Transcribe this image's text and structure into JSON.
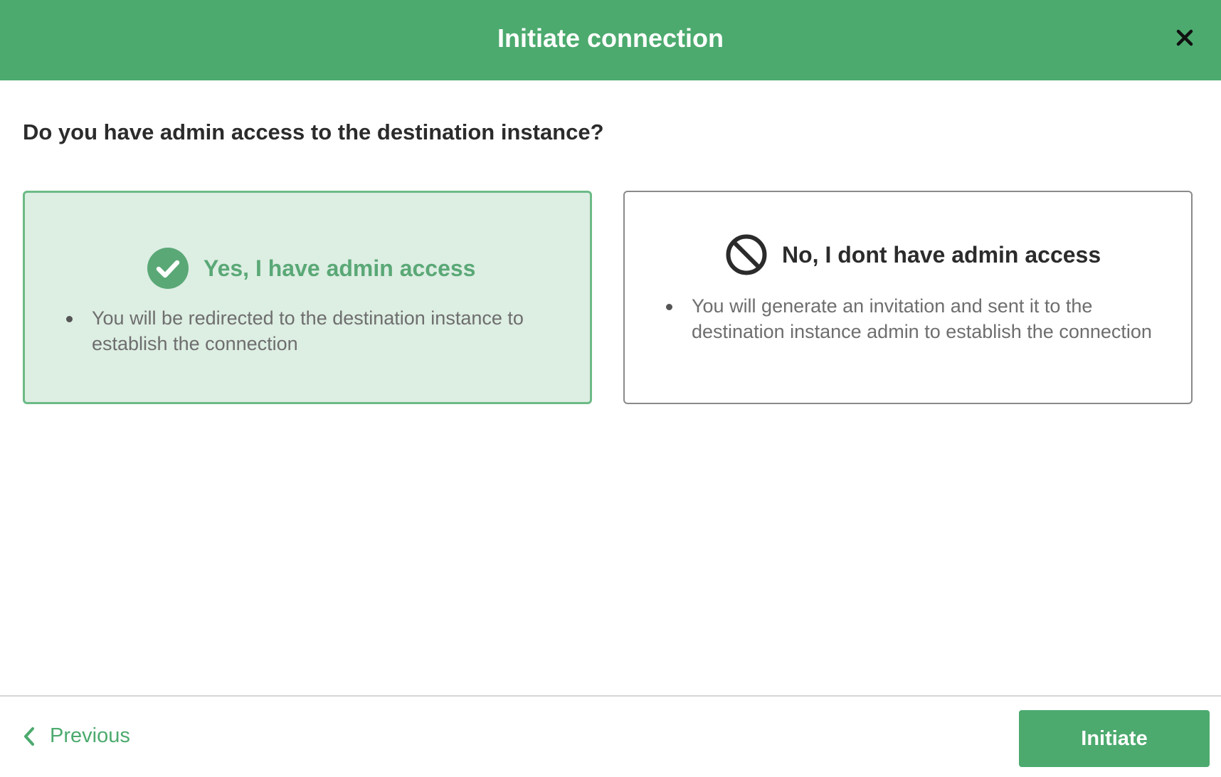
{
  "header": {
    "title": "Initiate connection",
    "close_icon": "close-icon"
  },
  "question": "Do you have admin access to the destination instance?",
  "options": [
    {
      "title": "Yes, I have admin access",
      "icon": "check-circle-icon",
      "selected": true,
      "bullets": [
        "You will be redirected to the destination instance to establish the connection"
      ]
    },
    {
      "title": "No, I dont have admin access",
      "icon": "no-entry-icon",
      "selected": false,
      "bullets": [
        "You will generate an invitation and sent it to the destination instance admin to establish the connection"
      ]
    }
  ],
  "footer": {
    "previous_label": "Previous",
    "previous_icon": "chevron-left-icon",
    "initiate_label": "Initiate"
  },
  "colors": {
    "brand_green": "#4caa6e",
    "selected_bg": "#ddeee3",
    "selected_border": "#6cba86",
    "text_dark": "#2b2b2b",
    "text_muted": "#6e6e6e"
  }
}
